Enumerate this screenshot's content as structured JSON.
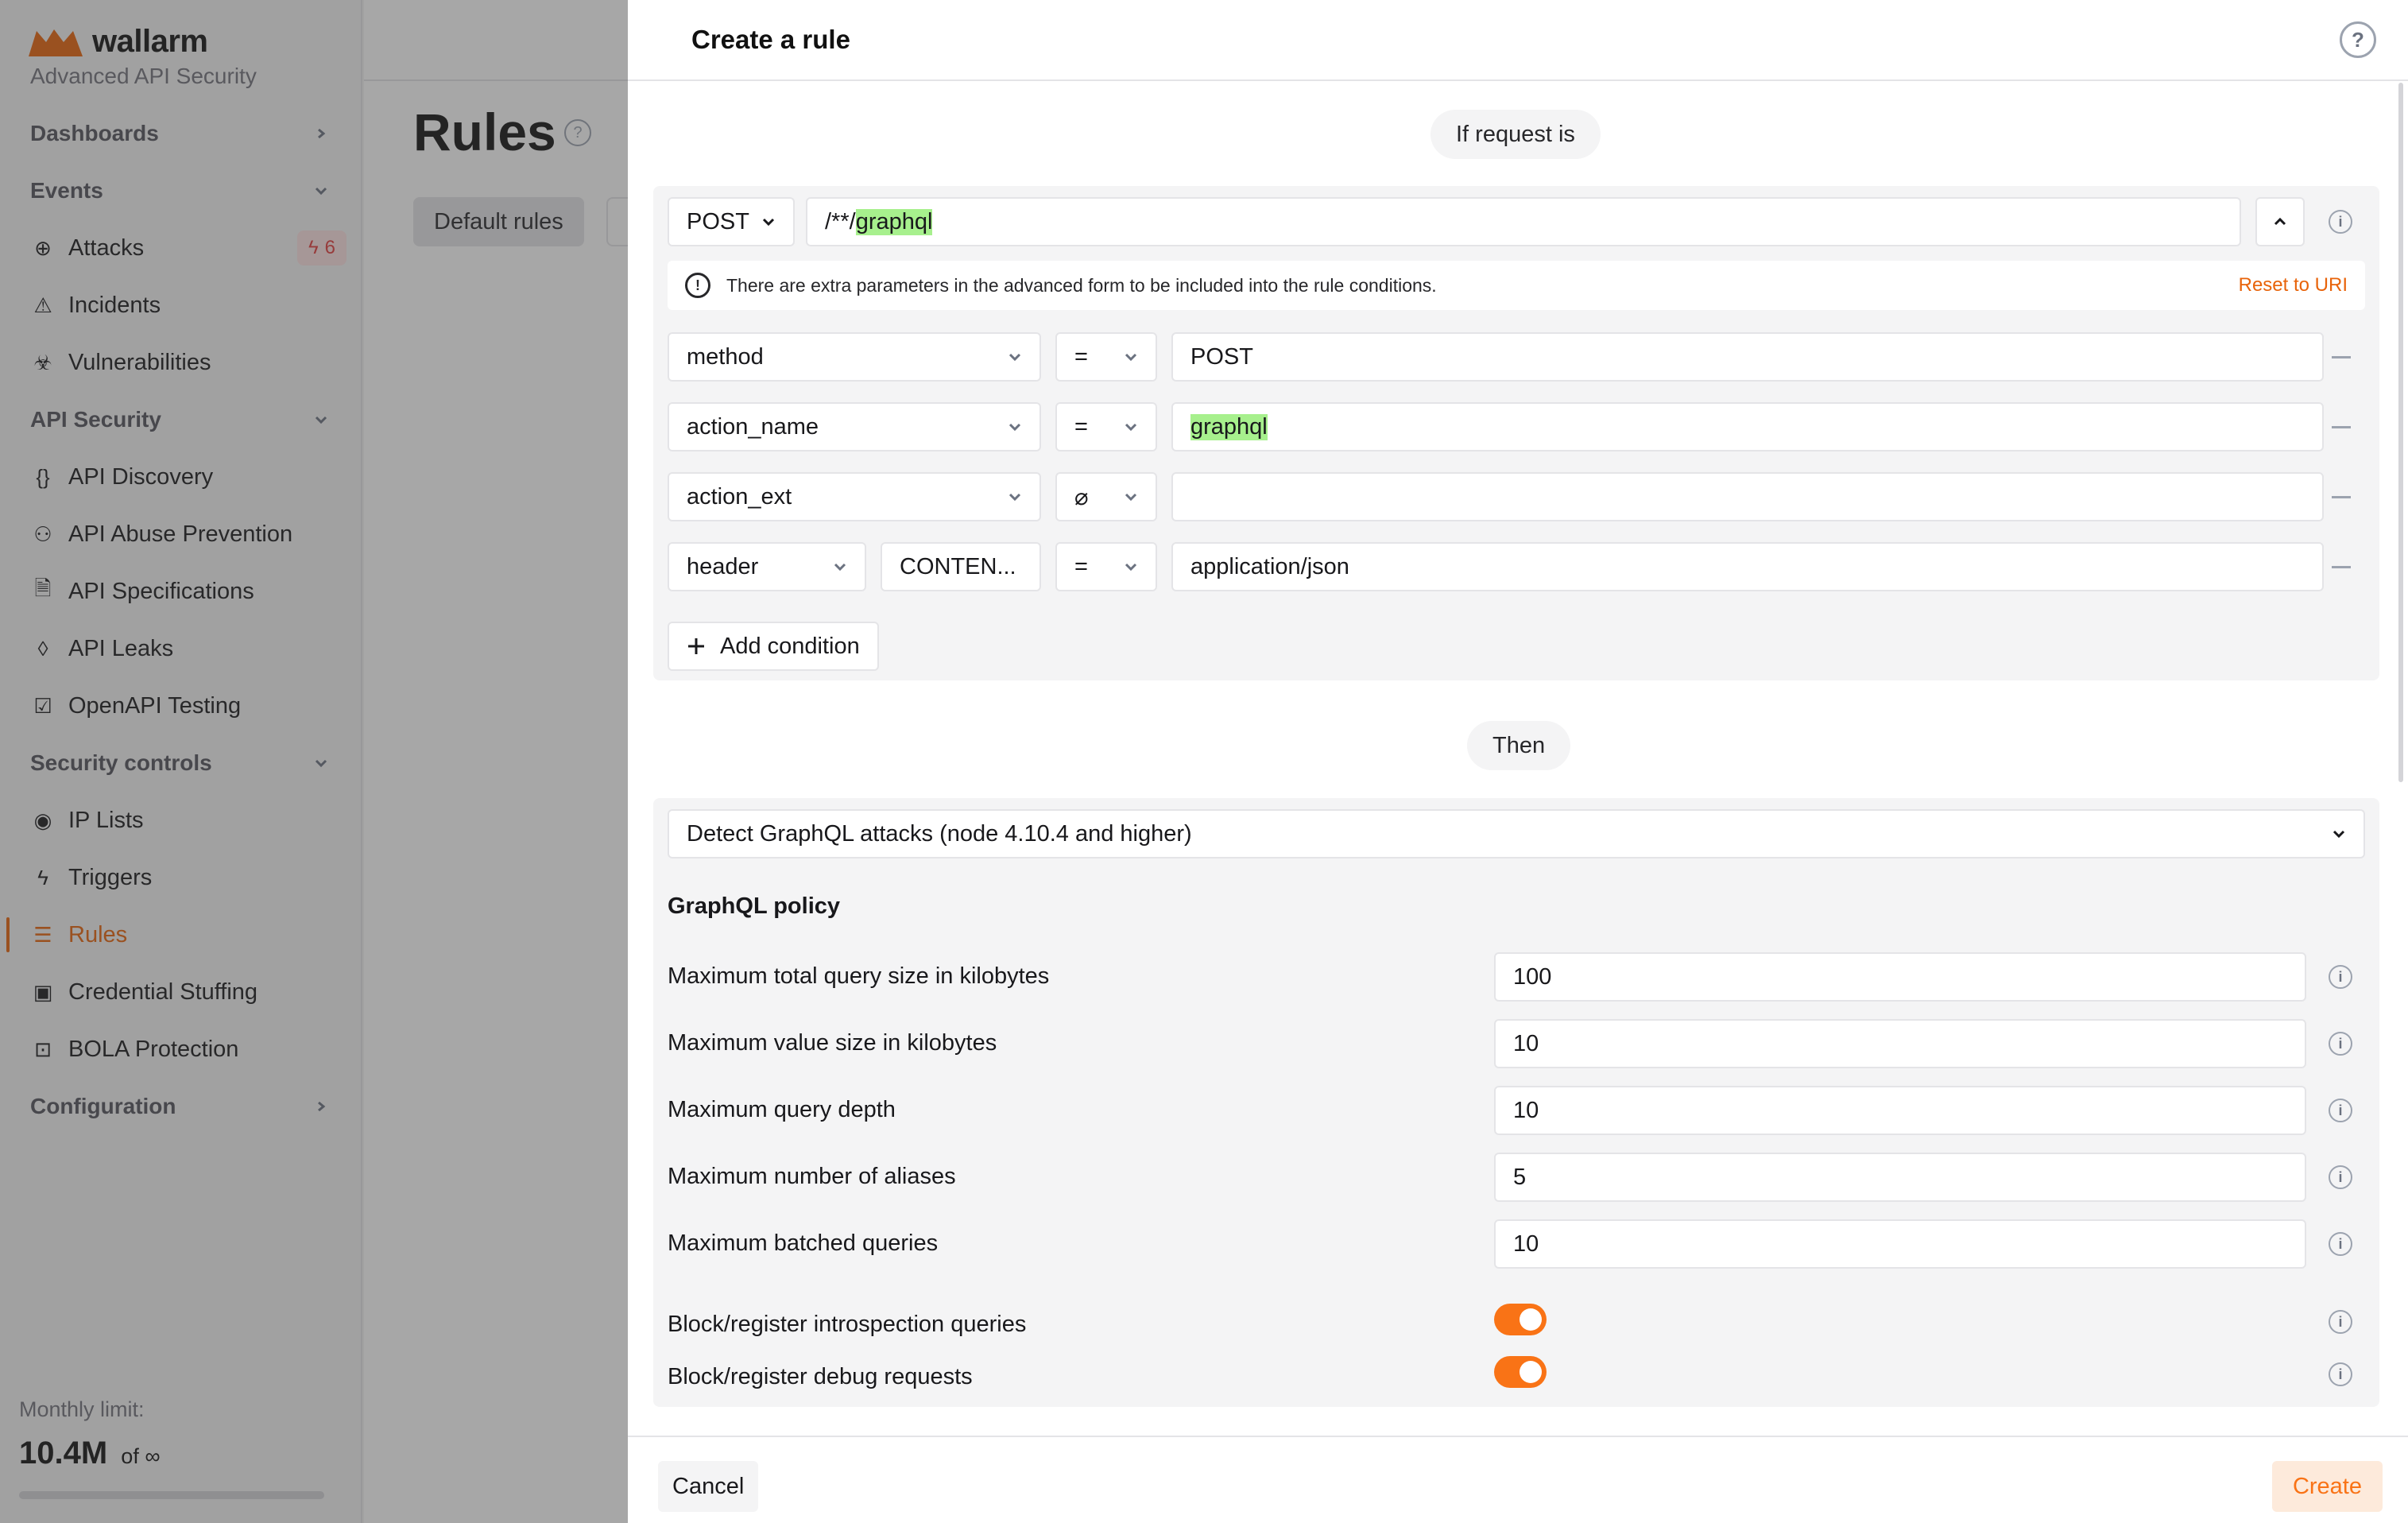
{
  "app": {
    "logo_text": "wallarm",
    "subtitle": "Advanced API Security",
    "brand_color": "#e8630a"
  },
  "sidebar": {
    "items": [
      {
        "type": "section",
        "label": "Dashboards",
        "chevron": "right"
      },
      {
        "type": "section",
        "label": "Events",
        "chevron": "down"
      },
      {
        "type": "item",
        "label": "Attacks",
        "icon": "crosshair-icon",
        "badge": "6"
      },
      {
        "type": "item",
        "label": "Incidents",
        "icon": "warning-triangle-icon"
      },
      {
        "type": "item",
        "label": "Vulnerabilities",
        "icon": "biohazard-icon"
      },
      {
        "type": "section",
        "label": "API Security",
        "chevron": "down"
      },
      {
        "type": "item",
        "label": "API Discovery",
        "icon": "braces-icon"
      },
      {
        "type": "item",
        "label": "API Abuse Prevention",
        "icon": "robot-icon"
      },
      {
        "type": "item",
        "label": "API Specifications",
        "icon": "document-icon"
      },
      {
        "type": "item",
        "label": "API Leaks",
        "icon": "drop-icon"
      },
      {
        "type": "item",
        "label": "OpenAPI Testing",
        "icon": "clipboard-check-icon"
      },
      {
        "type": "section",
        "label": "Security controls",
        "chevron": "down"
      },
      {
        "type": "item",
        "label": "IP Lists",
        "icon": "ip-icon"
      },
      {
        "type": "item",
        "label": "Triggers",
        "icon": "lightning-icon"
      },
      {
        "type": "item",
        "label": "Rules",
        "icon": "rules-list-icon",
        "active": true
      },
      {
        "type": "item",
        "label": "Credential Stuffing",
        "icon": "id-card-icon"
      },
      {
        "type": "item",
        "label": "BOLA Protection",
        "icon": "bola-icon"
      },
      {
        "type": "section",
        "label": "Configuration",
        "chevron": "right"
      }
    ],
    "monthly_limit": {
      "label": "Monthly limit:",
      "value": "10.4M",
      "of": "of ∞",
      "progress": 1.0
    }
  },
  "main": {
    "title": "Rules",
    "tabs": [
      "Default rules"
    ]
  },
  "drawer": {
    "title": "Create a rule",
    "if_label": "If request is",
    "method": "POST",
    "uri_prefix": "/**/",
    "uri_highlight": "graphql",
    "notice": "There are extra parameters in the advanced form to be included into the rule conditions.",
    "reset_label": "Reset to URI",
    "conditions": [
      {
        "param": "method",
        "operator": "=",
        "value": "POST"
      },
      {
        "param": "action_name",
        "operator": "=",
        "value": "graphql",
        "highlight": true
      },
      {
        "param": "action_ext",
        "operator": "⌀",
        "value": ""
      },
      {
        "param": "header",
        "sub": "CONTEN...",
        "operator": "=",
        "value": "application/json"
      }
    ],
    "add_condition_label": "Add condition",
    "then_label": "Then",
    "action_select": "Detect GraphQL attacks (node 4.10.4 and higher)",
    "policy": {
      "title": "GraphQL policy",
      "fields": [
        {
          "label": "Maximum total query size in kilobytes",
          "value": "100"
        },
        {
          "label": "Maximum value size in kilobytes",
          "value": "10"
        },
        {
          "label": "Maximum query depth",
          "value": "10"
        },
        {
          "label": "Maximum number of aliases",
          "value": "5"
        },
        {
          "label": "Maximum batched queries",
          "value": "10"
        }
      ],
      "toggles": [
        {
          "label": "Block/register introspection queries",
          "on": true
        },
        {
          "label": "Block/register debug requests",
          "on": true
        }
      ]
    },
    "cancel_label": "Cancel",
    "create_label": "Create"
  }
}
